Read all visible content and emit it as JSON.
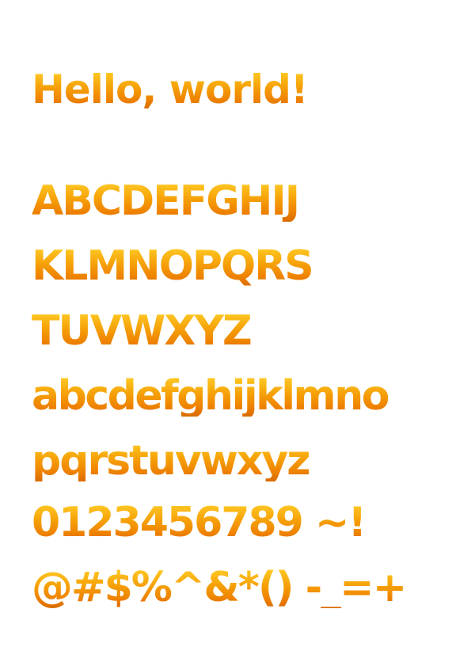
{
  "title": "Hello, world!",
  "charset_lines": [
    "ABCDEFGHIJ",
    "KLMNOPQRS",
    "TUVWXYZ",
    "abcdefghijklmno",
    "pqrstuvwxyz",
    "0123456789 ~!",
    "@#$%^&*() -_=+"
  ],
  "colors": {
    "text_top": "#ffcf2a",
    "text_mid": "#f7a50a",
    "text_bottom": "#d86a00",
    "background": "#ffffff"
  }
}
